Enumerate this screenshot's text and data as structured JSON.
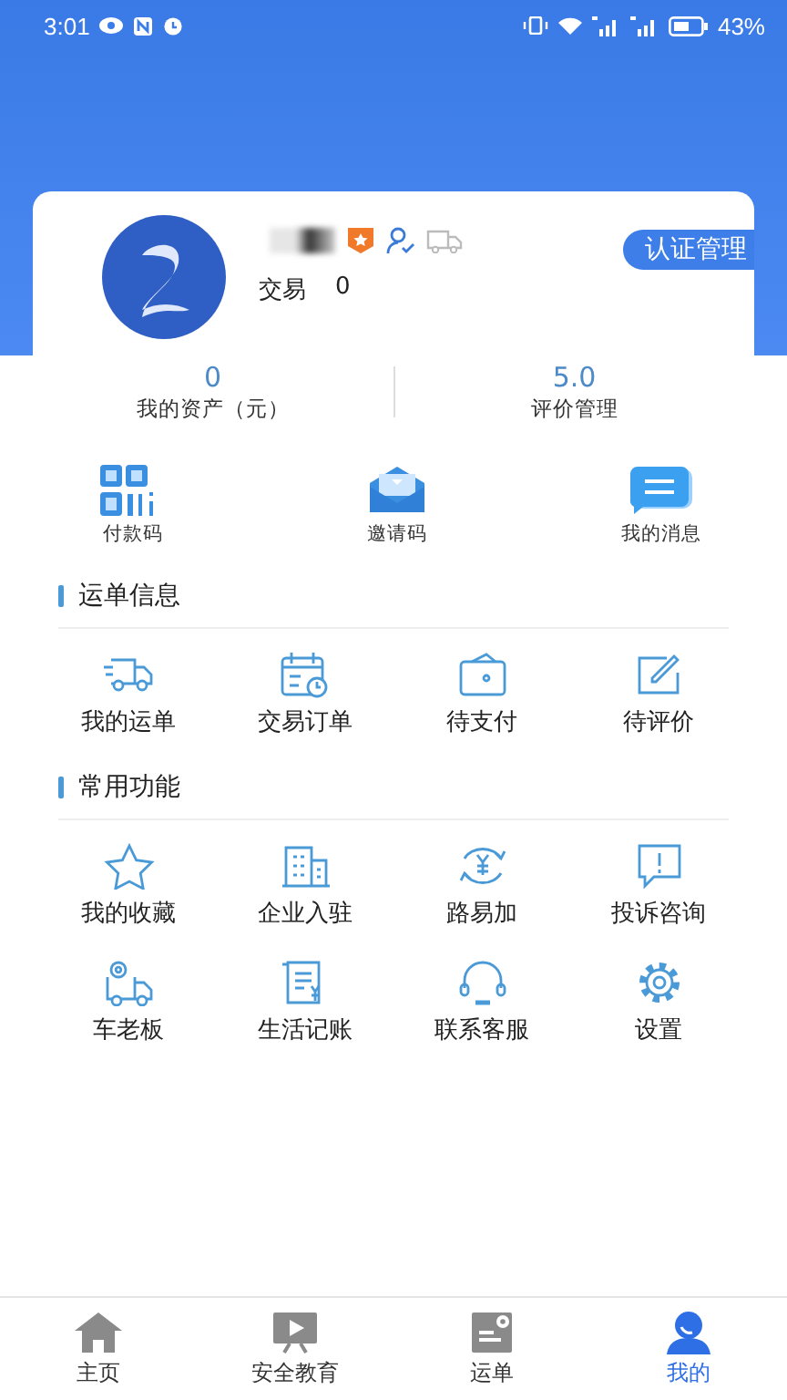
{
  "status_bar": {
    "time": "3:01",
    "battery": "43%"
  },
  "profile": {
    "trade_label": "交易",
    "trade_count": "0",
    "cert_button": "认证管理"
  },
  "stats": [
    {
      "value": "0",
      "label": "我的资产（元）"
    },
    {
      "value": "5.0",
      "label": "评价管理"
    }
  ],
  "shortcuts": [
    {
      "kind": "qr",
      "label": "付款码"
    },
    {
      "kind": "mail",
      "label": "邀请码"
    },
    {
      "kind": "message",
      "label": "我的消息"
    }
  ],
  "sections": [
    {
      "title": "运单信息",
      "items": [
        {
          "kind": "truck",
          "label": "我的运单"
        },
        {
          "kind": "calendar",
          "label": "交易订单"
        },
        {
          "kind": "wallet",
          "label": "待支付"
        },
        {
          "kind": "edit",
          "label": "待评价"
        }
      ]
    },
    {
      "title": "常用功能",
      "items": [
        {
          "kind": "star",
          "label": "我的收藏"
        },
        {
          "kind": "building",
          "label": "企业入驻"
        },
        {
          "kind": "exchange",
          "label": "路易加"
        },
        {
          "kind": "alert",
          "label": "投诉咨询"
        },
        {
          "kind": "truck-gear",
          "label": "车老板"
        },
        {
          "kind": "ledger",
          "label": "生活记账"
        },
        {
          "kind": "headset",
          "label": "联系客服"
        },
        {
          "kind": "gear",
          "label": "设置"
        }
      ]
    }
  ],
  "nav": [
    {
      "kind": "home",
      "label": "主页",
      "selected": false
    },
    {
      "kind": "video",
      "label": "安全教育",
      "selected": false
    },
    {
      "kind": "waybill",
      "label": "运单",
      "selected": false
    },
    {
      "kind": "person",
      "label": "我的",
      "selected": true
    }
  ]
}
